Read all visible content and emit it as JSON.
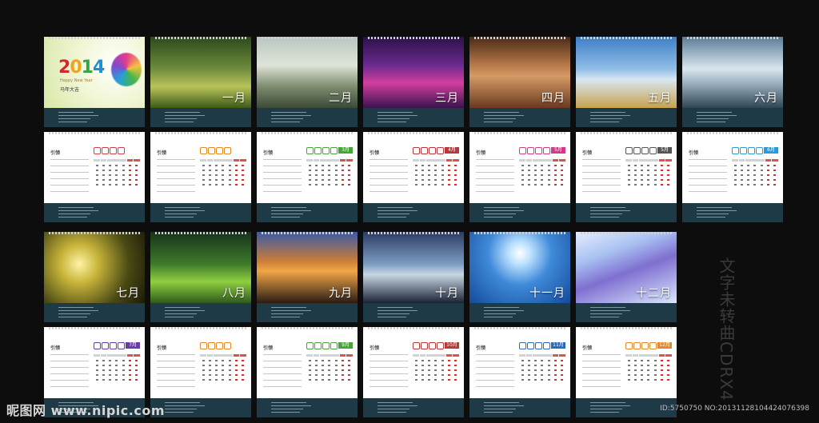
{
  "cover": {
    "year": [
      "2",
      "0",
      "1",
      "4"
    ],
    "subtitle_en": "Happy New Year",
    "subtitle_cn": "马年大吉"
  },
  "months": [
    {
      "label": "一月",
      "grad": "linear-gradient(180deg,#2c4a1c 0%,#6f8b3c 45%,#b9c35a 70%,#3d5a18 100%)"
    },
    {
      "label": "二月",
      "grad": "linear-gradient(180deg,#b9c6c2 0%,#dfe4d8 40%,#7d8c6f 70%,#3c4a36 100%)"
    },
    {
      "label": "三月",
      "grad": "linear-gradient(180deg,#2a1148 0%,#6a2a8e 40%,#d23f9d 65%,#3b124f 100%)"
    },
    {
      "label": "四月",
      "grad": "linear-gradient(180deg,#4a2a17 0%,#b87a4a 40%,#d59a66 55%,#6a3a1f 100%)"
    },
    {
      "label": "五月",
      "grad": "linear-gradient(180deg,#3e7fc7 0%,#8fbde6 45%,#d9e7f2 60%,#c8a24e 100%)"
    },
    {
      "label": "六月",
      "grad": "linear-gradient(180deg,#5b7d97 0%,#d9e6ee 45%,#9bb1c0 65%,#2f4555 100%)"
    },
    {
      "label": "七月",
      "grad": "radial-gradient(circle at 35% 45%,#fff3a6 0%,#c9b53a 25%,#4a4a14 65%,#1a1a08 100%)"
    },
    {
      "label": "八月",
      "grad": "linear-gradient(180deg,#16331c 0%,#3f7a2a 45%,#8fcf3f 70%,#2e5a1c 100%)"
    },
    {
      "label": "九月",
      "grad": "linear-gradient(180deg,#3a5aa8 0%,#c77c3a 40%,#f2a646 55%,#2a1c14 100%)"
    },
    {
      "label": "十月",
      "grad": "linear-gradient(180deg,#2c3c64 0%,#7a9bc0 45%,#c8d6e2 60%,#1a2236 100%)"
    },
    {
      "label": "十一月",
      "grad": "radial-gradient(circle at 50% 30%,#ffffff 0%,#bfe3ff 15%,#3f8ad9 45%,#154a9a 100%)"
    },
    {
      "label": "十二月",
      "grad": "linear-gradient(160deg,#e7ecff 0%,#a9c2f2 30%,#7f6fd0 55%,#d9e8ff 100%)"
    }
  ],
  "calendar_pages": [
    {
      "brand": "引领",
      "color": "#d23f3f",
      "tag": ""
    },
    {
      "brand": "引领",
      "color": "#e08a2a",
      "tag": ""
    },
    {
      "brand": "引领",
      "color": "#4aa33a",
      "tag": "3月"
    },
    {
      "brand": "引领",
      "color": "#b33a3a",
      "tag": "4月"
    },
    {
      "brand": "引领",
      "color": "#d2398a",
      "tag": "5月"
    },
    {
      "brand": "引领",
      "color": "#555555",
      "tag": "5月"
    },
    {
      "brand": "引领",
      "color": "#2a9ad6",
      "tag": "6月"
    },
    {
      "brand": "引领",
      "color": "#6a3aa8",
      "tag": "7月"
    },
    {
      "brand": "引领",
      "color": "#e08a2a",
      "tag": ""
    },
    {
      "brand": "引领",
      "color": "#4aa33a",
      "tag": "9月"
    },
    {
      "brand": "引领",
      "color": "#b33a3a",
      "tag": "10月"
    },
    {
      "brand": "引领",
      "color": "#2a6ab8",
      "tag": "11月"
    },
    {
      "brand": "引领",
      "color": "#e08a2a",
      "tag": "12月"
    }
  ],
  "watermark": "文字未转曲CDRX4",
  "site_logo": "昵图网 www.nipic.com",
  "id_line": "ID:5750750 NO:20131128104424076398"
}
